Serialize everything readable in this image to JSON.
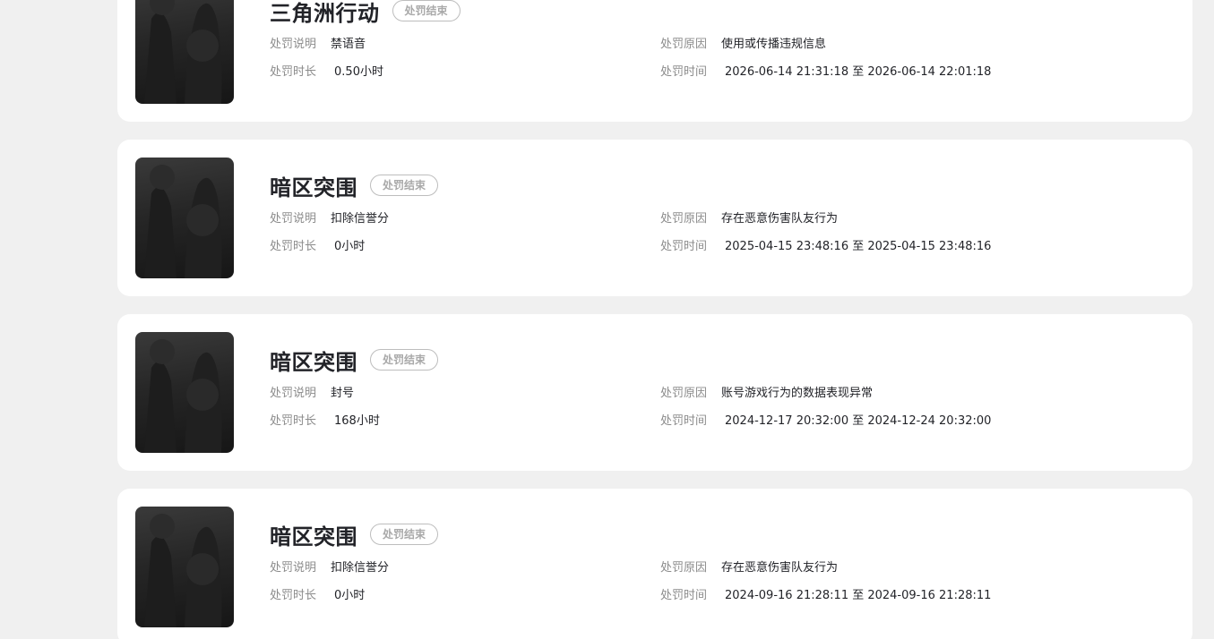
{
  "labels": {
    "description": "处罚说明",
    "reason": "处罚原因",
    "duration": "处罚时长",
    "time": "处罚时间"
  },
  "records": [
    {
      "game": "三角洲行动",
      "status": "处罚结束",
      "description": "禁语音",
      "reason": "使用或传播违规信息",
      "duration": "0.50小时",
      "time": "2026-06-14 21:31:18 至 2026-06-14 22:01:18"
    },
    {
      "game": "暗区突围",
      "status": "处罚结束",
      "description": "扣除信誉分",
      "reason": "存在恶意伤害队友行为",
      "duration": "0小时",
      "time": "2025-04-15 23:48:16 至 2025-04-15 23:48:16"
    },
    {
      "game": "暗区突围",
      "status": "处罚结束",
      "description": "封号",
      "reason": "账号游戏行为的数据表现异常",
      "duration": "168小时",
      "time": "2024-12-17 20:32:00 至 2024-12-24 20:32:00"
    },
    {
      "game": "暗区突围",
      "status": "处罚结束",
      "description": "扣除信誉分",
      "reason": "存在恶意伤害队友行为",
      "duration": "0小时",
      "time": "2024-09-16 21:28:11 至 2024-09-16 21:28:11"
    }
  ]
}
